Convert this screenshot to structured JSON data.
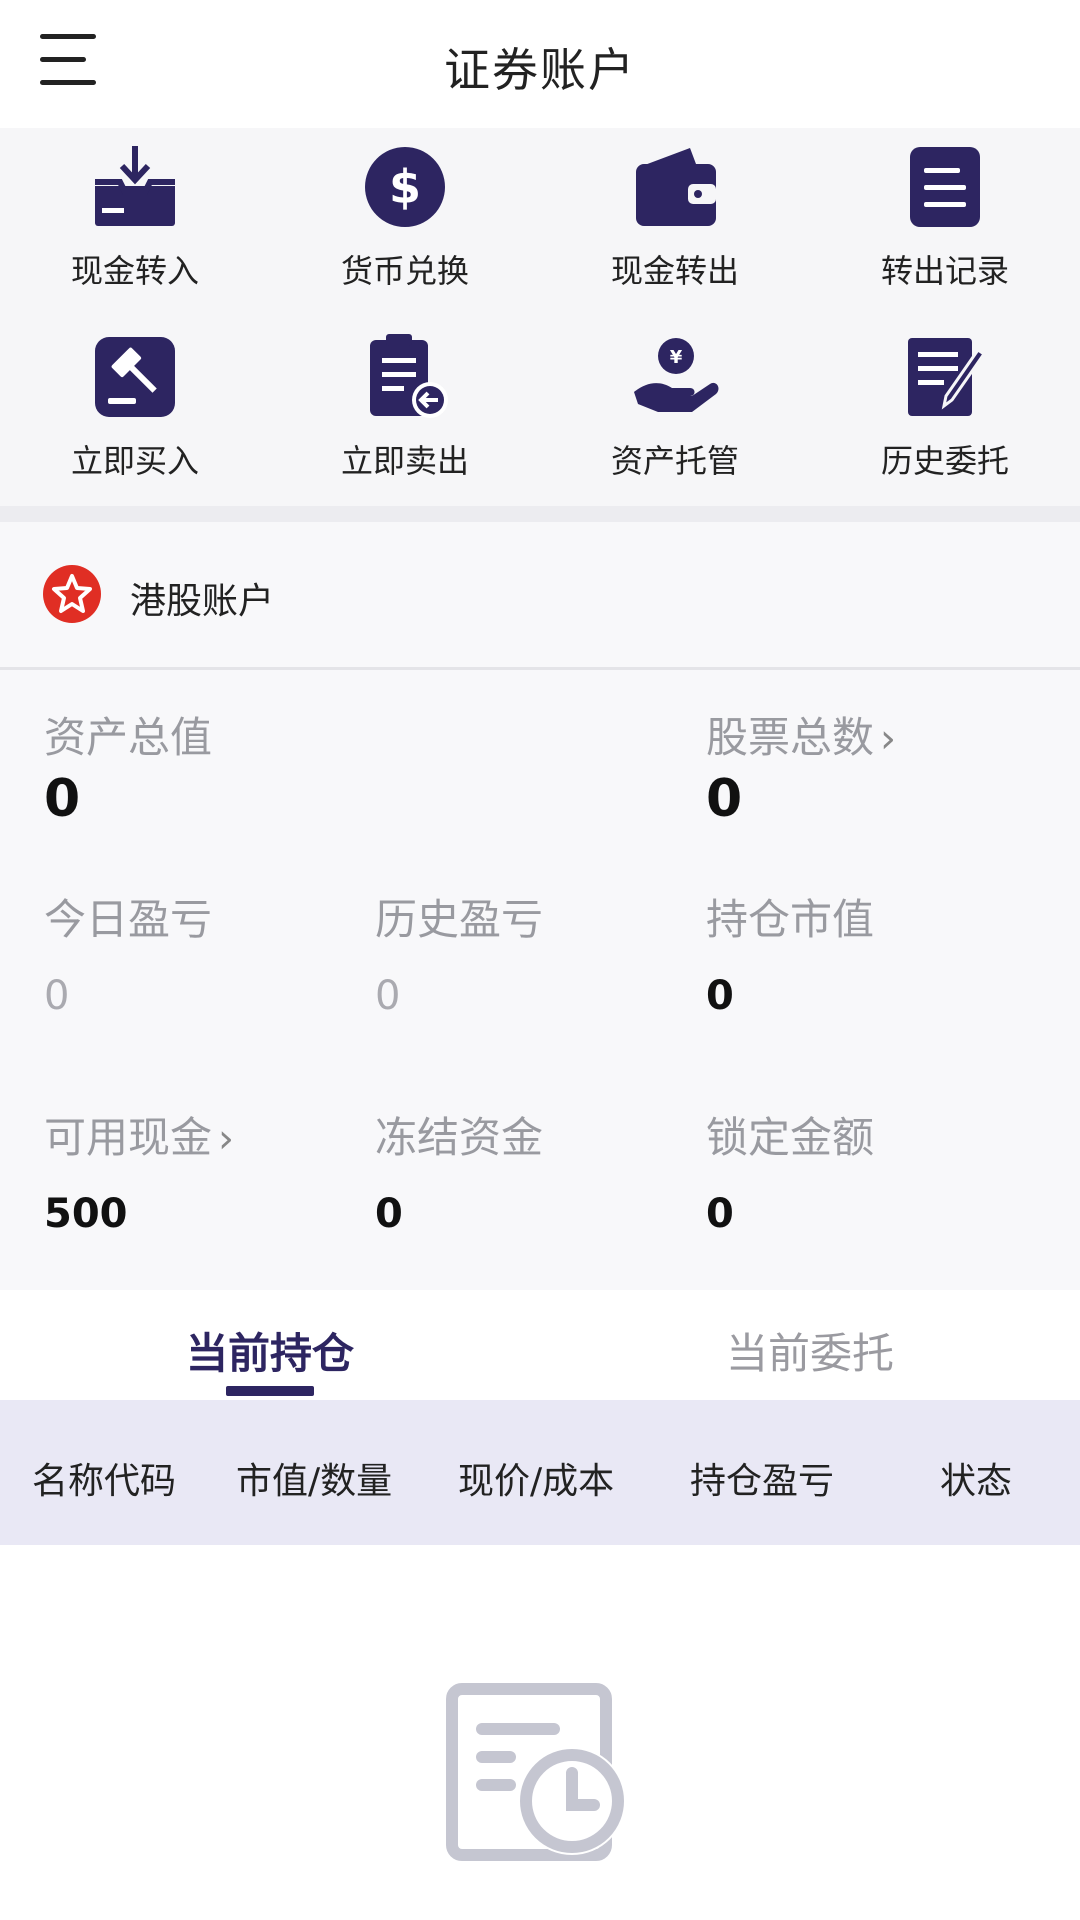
{
  "header": {
    "title": "证券账户"
  },
  "actions": [
    {
      "label": "现金转入",
      "icon": "cash-in-icon"
    },
    {
      "label": "货币兑换",
      "icon": "currency-exchange-icon"
    },
    {
      "label": "现金转出",
      "icon": "wallet-icon"
    },
    {
      "label": "转出记录",
      "icon": "record-list-icon"
    },
    {
      "label": "立即买入",
      "icon": "gavel-icon"
    },
    {
      "label": "立即卖出",
      "icon": "clipboard-sell-icon"
    },
    {
      "label": "资产托管",
      "icon": "asset-custody-icon"
    },
    {
      "label": "历史委托",
      "icon": "history-order-icon"
    }
  ],
  "account": {
    "name": "港股账户",
    "icon": "star-badge-icon",
    "icon_color": "#e02e24"
  },
  "stats": {
    "total_assets": {
      "label": "资产总值",
      "value": "0"
    },
    "total_stocks": {
      "label": "股票总数",
      "value": "0"
    },
    "today_pnl": {
      "label": "今日盈亏",
      "value": "0"
    },
    "history_pnl": {
      "label": "历史盈亏",
      "value": "0"
    },
    "position_value": {
      "label": "持仓市值",
      "value": "0"
    },
    "available_cash": {
      "label": "可用现金",
      "value": "500"
    },
    "frozen_funds": {
      "label": "冻结资金",
      "value": "0"
    },
    "locked_amount": {
      "label": "锁定金额",
      "value": "0"
    }
  },
  "tabs": [
    {
      "label": "当前持仓",
      "active": true
    },
    {
      "label": "当前委托",
      "active": false
    }
  ],
  "table": {
    "columns": [
      "名称代码",
      "市值/数量",
      "现价/成本",
      "持仓盈亏",
      "状态"
    ],
    "rows": []
  },
  "empty_state": {
    "icon": "empty-document-clock-icon"
  },
  "colors": {
    "accent": "#2d2561",
    "table_header_bg": "#e9e8f5",
    "panel_bg": "#f8f8fa"
  }
}
